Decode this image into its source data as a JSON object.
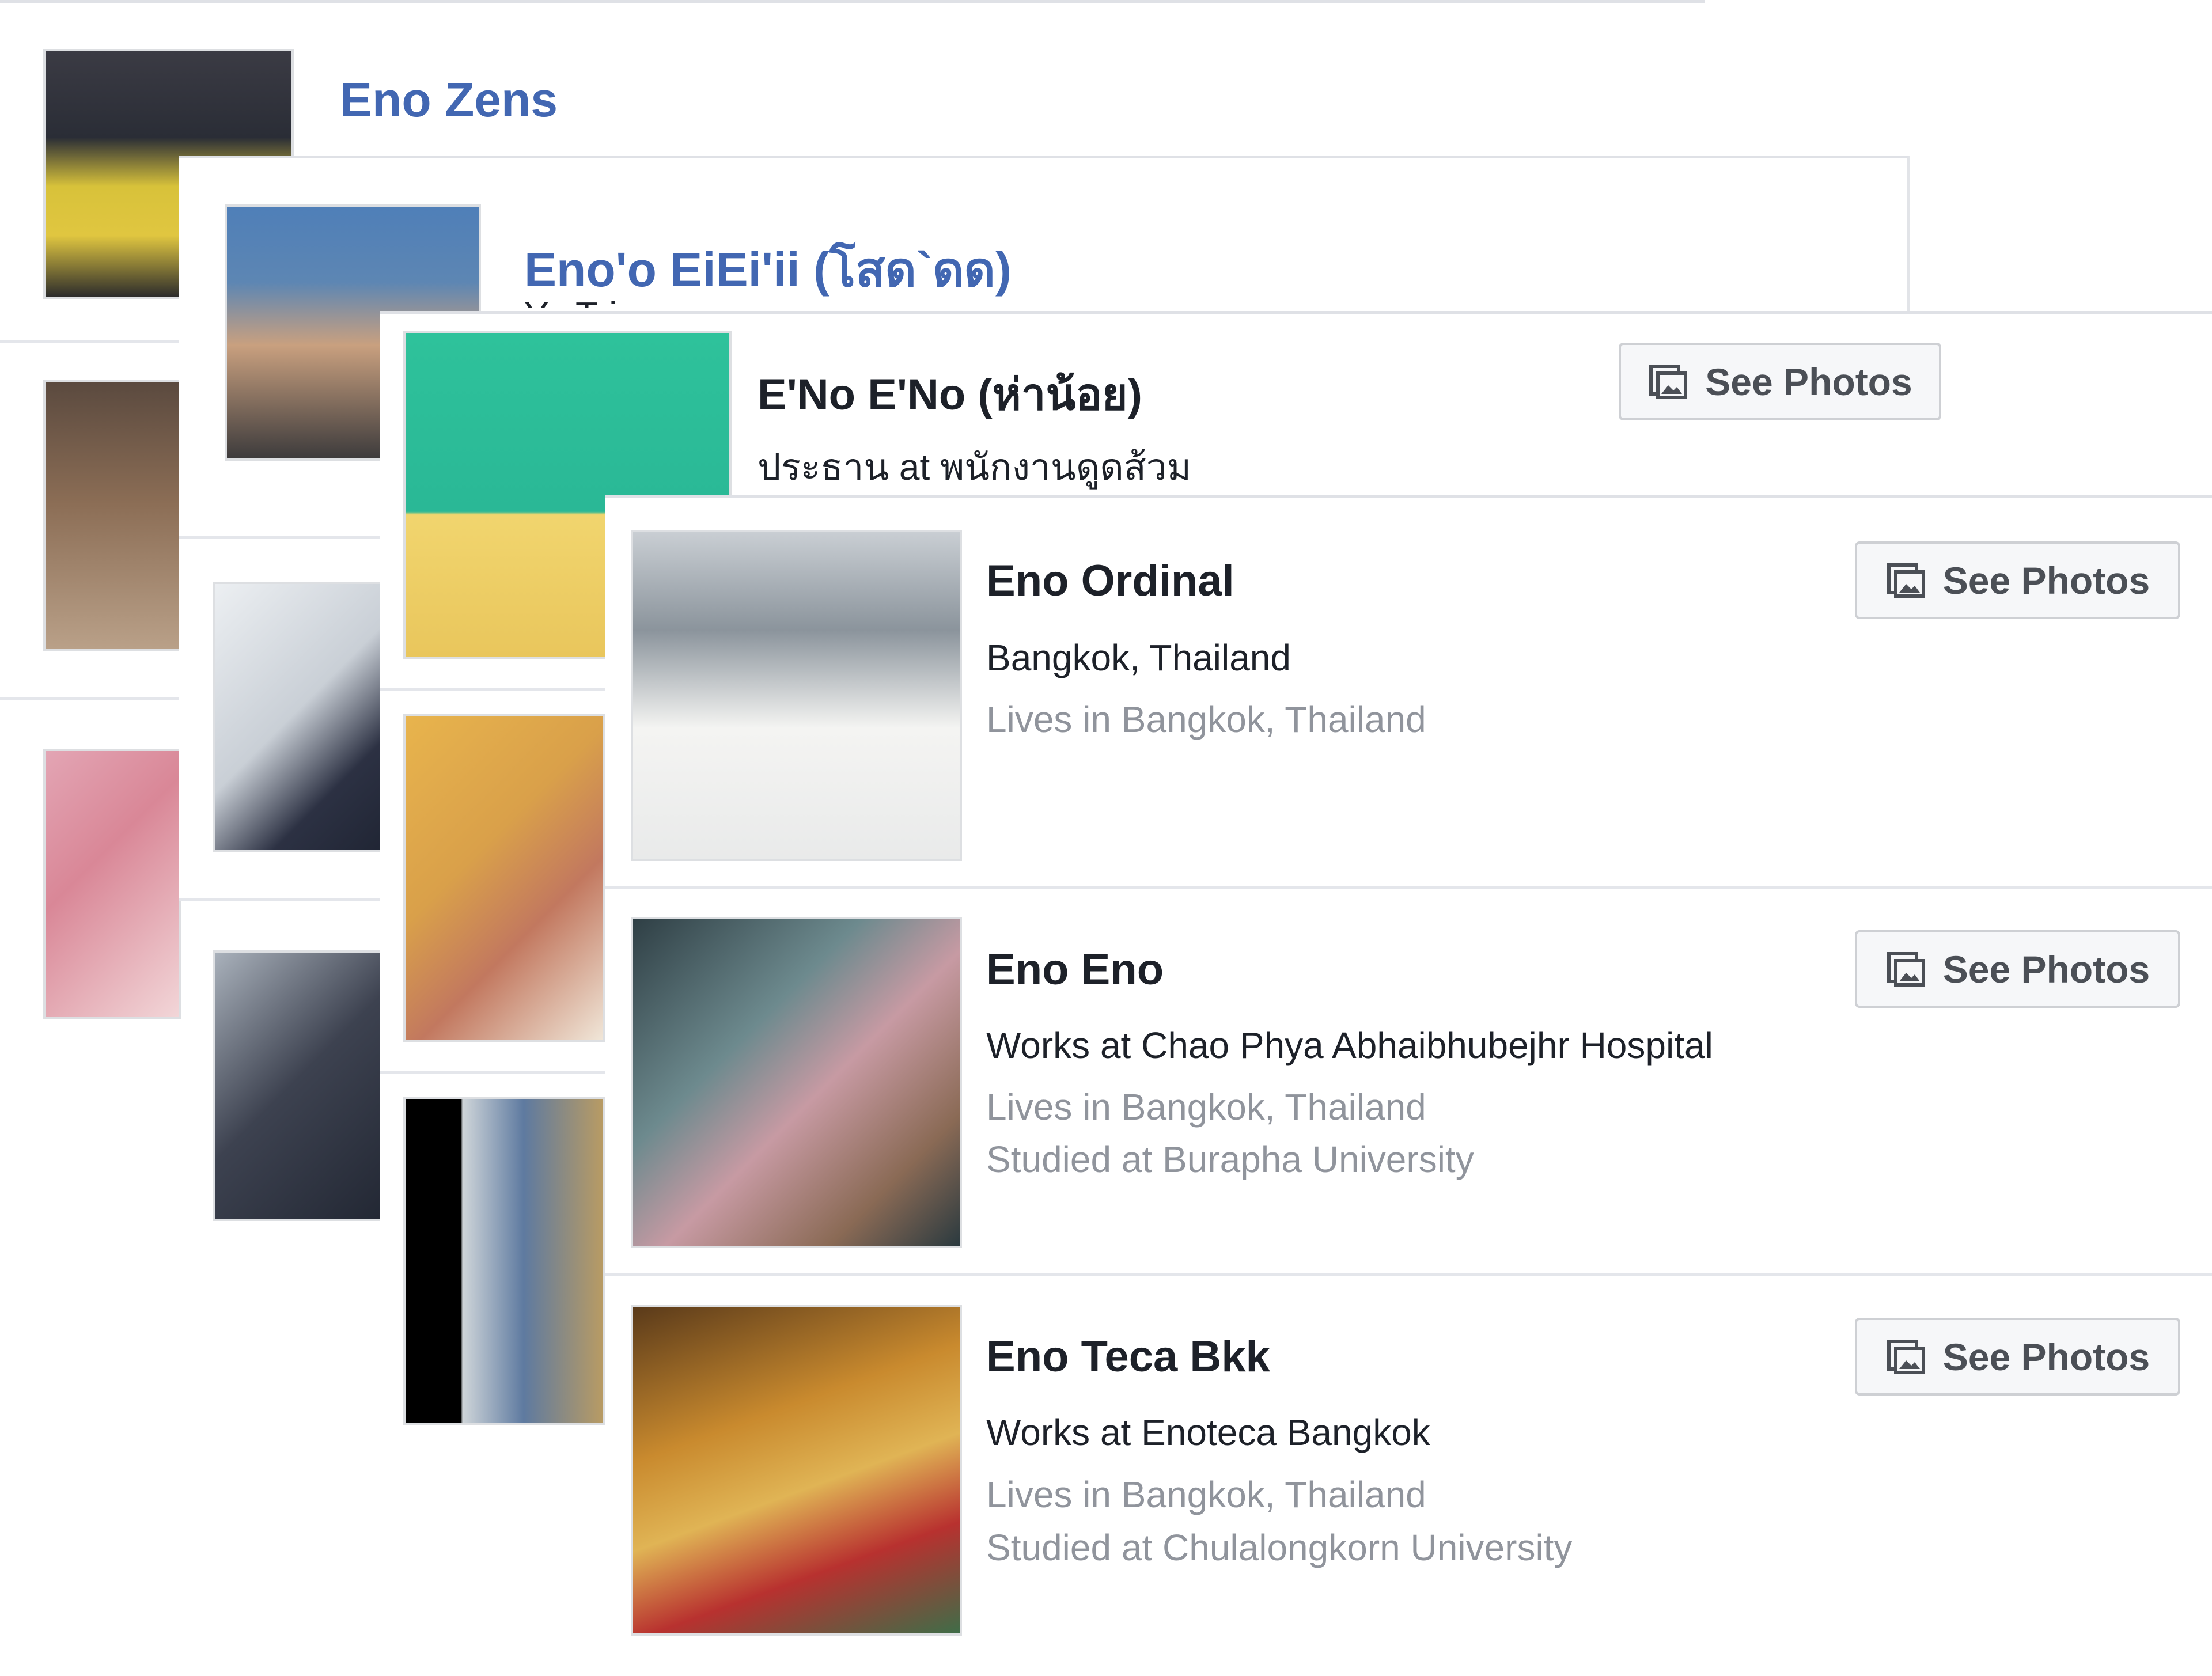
{
  "results": [
    {
      "name": "Eno Zens"
    },
    {
      "name": "Eno'o EiEi'ii (โสด`ดด)",
      "detail": "Yo Tri"
    },
    {
      "name": "E'No E'No (ห่าน้อย)",
      "detail": "ประธาน at พนักงานดูดส้วม",
      "button": "See Photos"
    },
    {
      "name": "Eno Ordinal",
      "detail": "Bangkok, Thailand",
      "lives": "Lives in Bangkok, Thailand",
      "button": "See Photos"
    },
    {
      "name": "Eno Eno",
      "detail": "Works at Chao Phya Abhaibhubejhr Hospital",
      "lives": "Lives in Bangkok, Thailand",
      "studied": "Studied at Burapha University",
      "button": "See Photos"
    },
    {
      "name": "Eno Teca Bkk",
      "detail": "Works at Enoteca Bangkok",
      "lives": "Lives in Bangkok, Thailand",
      "studied": "Studied at Chulalongkorn University",
      "button": "See Photos"
    }
  ],
  "photo_icon": "photo-album-icon",
  "colors": {
    "link": "#4267b2",
    "text": "#1d2129",
    "muted": "#90949c",
    "button_bg": "#f6f7f9",
    "border": "#dddfe2"
  }
}
